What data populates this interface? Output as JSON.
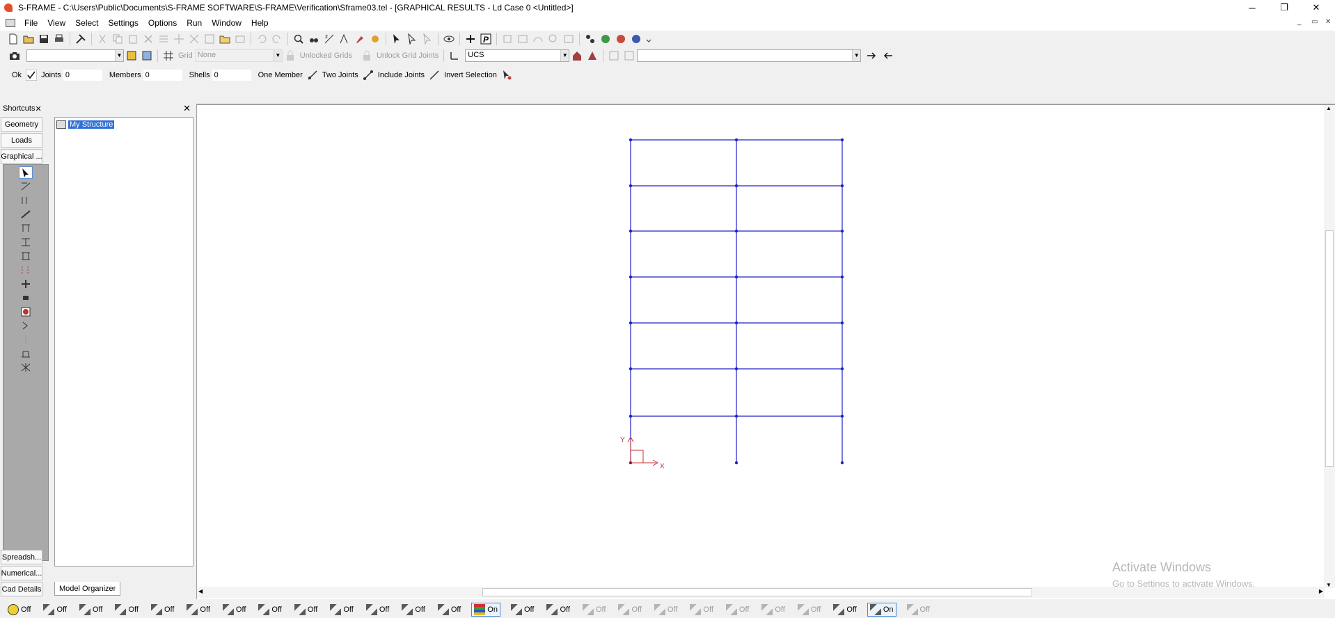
{
  "window": {
    "title": "S-FRAME - C:\\Users\\Public\\Documents\\S-FRAME SOFTWARE\\S-FRAME\\Verification\\Sframe03.tel - [GRAPHICAL RESULTS - Ld Case 0 <Untitled>]",
    "minimize": "─",
    "restore": "❐",
    "close": "✕"
  },
  "menu": {
    "items": [
      "File",
      "View",
      "Select",
      "Settings",
      "Options",
      "Run",
      "Window",
      "Help"
    ],
    "mdi_controls": [
      "_",
      "▭",
      "✕"
    ]
  },
  "toolbar2": {
    "grid_label": "Grid",
    "grid_value": "None",
    "unlocked_grids": "Unlocked Grids",
    "unlock_grid_joints": "Unlock Grid Joints",
    "ucs_value": "UCS"
  },
  "selectbar": {
    "ok_label": "Ok",
    "joints_label": "Joints",
    "joints_value": "0",
    "members_label": "Members",
    "members_value": "0",
    "shells_label": "Shells",
    "shells_value": "0",
    "one_member": "One Member",
    "two_joints": "Two Joints",
    "include_joints": "Include Joints",
    "invert_selection": "Invert Selection"
  },
  "shortcuts": {
    "title": "Shortcuts",
    "close": "✕",
    "buttons": [
      "Geometry",
      "Loads",
      "Graphical ..."
    ],
    "bottom_buttons": [
      "Spreadsh...",
      "Numerical...",
      "Cad Details"
    ]
  },
  "tree": {
    "close": "✕",
    "root": "My Structure",
    "tab": "Model Organizer"
  },
  "canvas": {
    "axis_x": "X",
    "axis_y": "Y",
    "watermark_title": "Activate Windows",
    "watermark_sub": "Go to Settings to activate Windows.",
    "frame_color": "#2020c8",
    "axis_color": "#c83030"
  },
  "statusbar": {
    "toggles": [
      {
        "icon": "smiley-icon",
        "state": "Off"
      },
      {
        "icon": "joint-labels-icon",
        "state": "Off"
      },
      {
        "icon": "member-labels-icon",
        "state": "Off"
      },
      {
        "icon": "joint-dot-icon",
        "state": "Off"
      },
      {
        "icon": "member-orient-icon",
        "state": "Off"
      },
      {
        "icon": "shell-icon",
        "state": "Off"
      },
      {
        "icon": "support-icon",
        "state": "Off"
      },
      {
        "icon": "release-icon",
        "state": "Off"
      },
      {
        "icon": "search-joint-icon",
        "state": "Off"
      },
      {
        "icon": "section-icon",
        "state": "Off"
      },
      {
        "icon": "load-arrow-icon",
        "state": "Off"
      },
      {
        "icon": "vertical-load-icon",
        "state": "Off"
      },
      {
        "icon": "spring-icon",
        "state": "Off"
      },
      {
        "icon": "color-legend-icon",
        "state": "On"
      },
      {
        "icon": "extrude-icon",
        "state": "Off"
      },
      {
        "icon": "node-select-icon",
        "state": "Off"
      },
      {
        "icon": "deflected-icon",
        "state": "Off"
      },
      {
        "icon": "plane-icon",
        "state": "Off"
      },
      {
        "icon": "grid-frame-icon",
        "state": "Off"
      },
      {
        "icon": "window-frame-icon",
        "state": "Off"
      },
      {
        "icon": "page-icon",
        "state": "Off"
      },
      {
        "icon": "mesh-icon",
        "state": "Off"
      },
      {
        "icon": "multi-grid-icon",
        "state": "Off"
      },
      {
        "icon": "diagonal-icon",
        "state": "Off"
      },
      {
        "icon": "ruler-icon",
        "state": "On"
      },
      {
        "icon": "pointer-icon",
        "state": "Off"
      }
    ]
  }
}
